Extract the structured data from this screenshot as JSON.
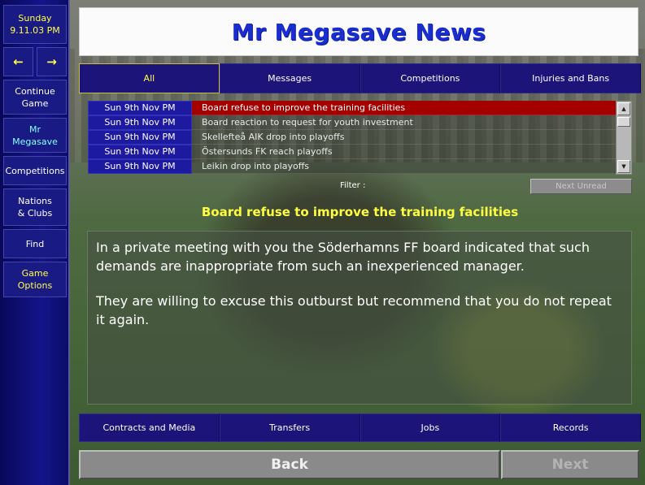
{
  "sidebar": {
    "day": "Sunday",
    "date": "9.11.03 PM",
    "back_arrow": "←",
    "forward_arrow": "→",
    "items": [
      {
        "label": "Continue Game"
      },
      {
        "label": "Mr Megasave"
      },
      {
        "label": "Competitions"
      },
      {
        "label": "Nations & Clubs"
      },
      {
        "label": "Find"
      },
      {
        "label": "Game Options"
      }
    ]
  },
  "header": {
    "title": "Mr Megasave News"
  },
  "top_tabs": [
    {
      "label": "All",
      "active": true
    },
    {
      "label": "Messages"
    },
    {
      "label": "Competitions"
    },
    {
      "label": "Injuries and Bans"
    }
  ],
  "news_list": [
    {
      "date": "Sun 9th Nov PM",
      "headline": "Board refuse to improve the training facilities",
      "selected": true
    },
    {
      "date": "Sun 9th Nov PM",
      "headline": "Board reaction to request for youth investment"
    },
    {
      "date": "Sun 9th Nov PM",
      "headline": "Skellefteå AIK drop into playoffs"
    },
    {
      "date": "Sun 9th Nov PM",
      "headline": "Östersunds FK reach playoffs"
    },
    {
      "date": "Sun 9th Nov PM",
      "headline": "Leikin drop into playoffs"
    }
  ],
  "filter": {
    "label": "Filter :",
    "next_unread": "Next Unread"
  },
  "article": {
    "headline": "Board refuse to improve the training facilities",
    "paragraphs": [
      "In a private meeting with you the Söderhamns FF board indicated that such demands are inappropriate from such an inexperienced manager.",
      "They are willing to excuse this outburst but recommend that you do not repeat it again."
    ]
  },
  "bottom_tabs": [
    {
      "label": "Contracts and Media"
    },
    {
      "label": "Transfers"
    },
    {
      "label": "Jobs"
    },
    {
      "label": "Records"
    }
  ],
  "buttons": {
    "back": "Back",
    "next": "Next"
  },
  "colors": {
    "accent_yellow": "#ffff44",
    "title_blue": "#1a2ed0",
    "selected_red": "#a40000",
    "panel_navy": "#1c1478"
  }
}
